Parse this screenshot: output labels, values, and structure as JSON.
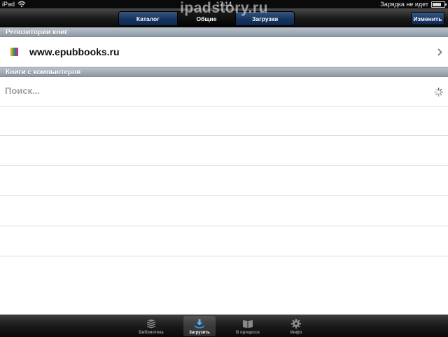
{
  "status": {
    "carrier": "iPad",
    "time": "17:14",
    "charging": "Зарядка не идет"
  },
  "watermark": "ipadstory.ru",
  "navbar": {
    "segments": [
      "Каталог",
      "Общие",
      "Загрузки"
    ],
    "selected_segment": "Общие",
    "edit_label": "Изменить"
  },
  "sections": {
    "repositories": {
      "header": "Репозитории книг",
      "item": "www.epubbooks.ru"
    },
    "computers": {
      "header": "Книги с компьютеров",
      "search_status": "Поиск..."
    }
  },
  "tabbar": {
    "tabs": [
      {
        "label": "Библиотека",
        "icon": "books-stack-icon"
      },
      {
        "label": "Загрузить",
        "icon": "download-icon"
      },
      {
        "label": "В процессе",
        "icon": "open-book-icon"
      },
      {
        "label": "Инфо",
        "icon": "gear-icon"
      }
    ],
    "selected": "Загрузить"
  },
  "colors": {
    "navbar": "#121212",
    "segment_blue": "#16345f",
    "section_header": "#98a3ae",
    "placeholder_gray": "#a0a0a0"
  }
}
